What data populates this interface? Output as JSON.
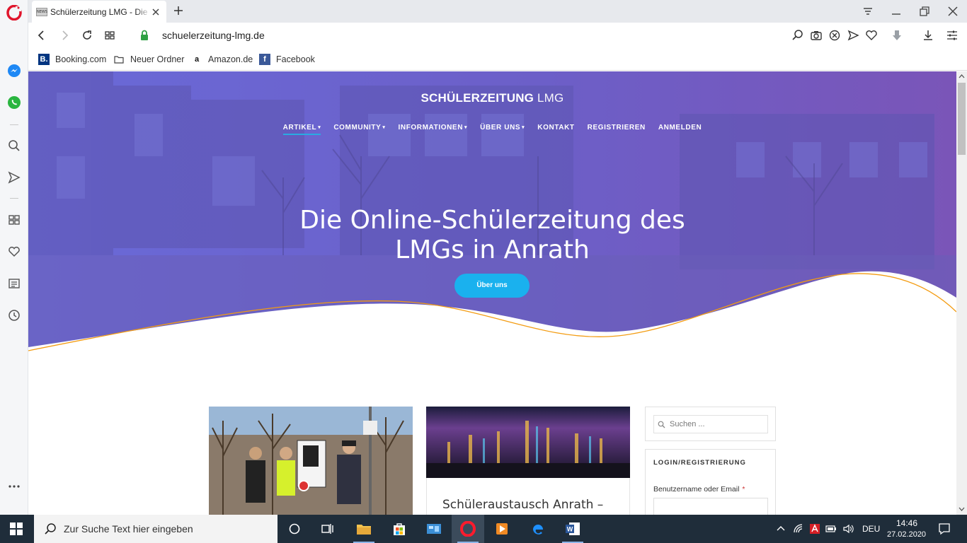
{
  "browser": {
    "tab": {
      "title": "Schülerzeitung LMG - Die Online-Schülerzeitung",
      "favicon_text": "NEWS"
    },
    "url": "schuelerzeitung-lmg.de",
    "bookmarks": [
      {
        "label": "Booking.com",
        "icon": "booking-icon"
      },
      {
        "label": "Neuer Ordner",
        "icon": "folder-icon"
      },
      {
        "label": "Amazon.de",
        "icon": "amazon-icon"
      },
      {
        "label": "Facebook",
        "icon": "facebook-icon"
      }
    ],
    "sidebar_icons": [
      "opera-logo-icon",
      "messenger-icon",
      "whatsapp-icon",
      "search-icon",
      "send-icon",
      "speed-dial-icon",
      "heart-icon",
      "news-icon",
      "history-icon",
      "more-icon"
    ],
    "accent_color": "#e0152c"
  },
  "site": {
    "title_bold": "SCHÜLERZEITUNG",
    "title_thin": "LMG",
    "nav": [
      {
        "label": "ARTIKEL",
        "dropdown": true,
        "active": true
      },
      {
        "label": "COMMUNITY",
        "dropdown": true
      },
      {
        "label": "INFORMATIONEN",
        "dropdown": true
      },
      {
        "label": "ÜBER UNS",
        "dropdown": true
      },
      {
        "label": "KONTAKT"
      },
      {
        "label": "REGISTRIEREN"
      },
      {
        "label": "ANMELDEN"
      }
    ],
    "caret": "▾",
    "headline_line1": "Die Online-Schülerzeitung des",
    "headline_line2": "LMGs in Anrath",
    "hero_button": "Über uns",
    "hero_overlay_color": "#6a5fd0",
    "button_color": "#1ab1ee",
    "wave_line_color": "#f39c12",
    "card2_title": "Schüleraustausch Anrath –",
    "search_placeholder": "Suchen ...",
    "widget_title": "LOGIN/REGISTRIERUNG",
    "username_label": "Benutzername oder Email",
    "required_marker": "*"
  },
  "taskbar": {
    "search_placeholder": "Zur Suche Text hier eingeben",
    "language": "DEU",
    "time": "14:46",
    "date": "27.02.2020"
  }
}
